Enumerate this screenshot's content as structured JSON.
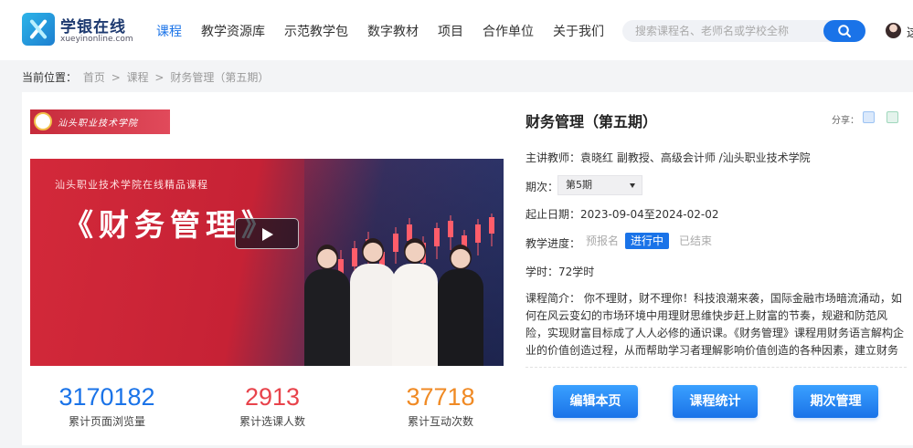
{
  "header": {
    "logo_title": "学银在线",
    "logo_sub": "xueyinonline.com",
    "nav": [
      {
        "label": "课程",
        "active": true
      },
      {
        "label": "教学资源库"
      },
      {
        "label": "示范教学包"
      },
      {
        "label": "数字教材"
      },
      {
        "label": "项目"
      },
      {
        "label": "合作单位"
      },
      {
        "label": "关于我们"
      }
    ],
    "search_placeholder": "搜索课程名、老师名或学校全称",
    "user_char": "这"
  },
  "breadcrumb": {
    "label": "当前位置：",
    "items": [
      "首页",
      "课程",
      "财务管理（第五期）"
    ],
    "separator": ">"
  },
  "banner": {
    "school_name": "汕头职业技术学院",
    "subtitle": "汕头职业技术学院在线精品课程",
    "title": "《财务管理》"
  },
  "stats": [
    {
      "value": "3170182",
      "label": "累计页面浏览量",
      "color": "#1a73e8"
    },
    {
      "value": "2913",
      "label": "累计选课人数",
      "color": "#e8434b"
    },
    {
      "value": "37718",
      "label": "累计互动次数",
      "color": "#f08a24"
    }
  ],
  "course": {
    "title": "财务管理（第五期）",
    "share_label": "分享：",
    "teacher": "主讲教师：袁晓红 副教授、高级会计师 /汕头职业技术学院",
    "term_label": "期次：",
    "term_value": "第5期",
    "date_range": "起止日期：2023-09-04至2024-02-02",
    "progress_label": "教学进度：",
    "progress_steps": [
      "预报名",
      "进行中",
      "已结束"
    ],
    "hours": "学时：72学时",
    "intro": "课程简介：  你不理财，财不理你！科技浪潮来袭，国际金融市场暗流涌动，如何在风云变幻的市场环境中用理财思维快步赶上财富的节奏，规避和防范风险，实现财富目标成了人人必修的通识课。《财务管理》课程用财务语言解构企业的价值创造过程，从而帮助学习者理解影响价值创造的各种因素，建立财务思维，树立正确的金钱观，培养优..."
  },
  "actions": {
    "edit": "编辑本页",
    "stats": "课程统计",
    "terms": "期次管理"
  }
}
